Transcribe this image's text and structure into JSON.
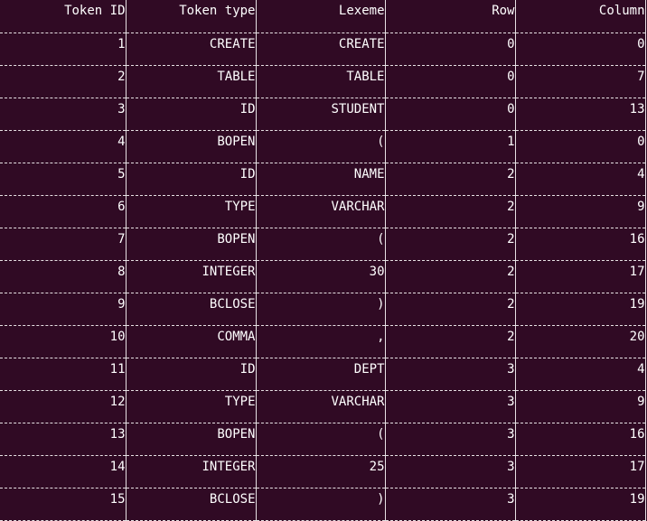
{
  "terminal": {
    "headers": [
      "Token ID",
      "Token type",
      "Lexeme",
      "Row",
      "Column"
    ],
    "rows": [
      [
        "1",
        "CREATE",
        "CREATE",
        "0",
        "0"
      ],
      [
        "2",
        "TABLE",
        "TABLE",
        "0",
        "7"
      ],
      [
        "3",
        "ID",
        "STUDENT",
        "0",
        "13"
      ],
      [
        "4",
        "BOPEN",
        "(",
        "1",
        "0"
      ],
      [
        "5",
        "ID",
        "NAME",
        "2",
        "4"
      ],
      [
        "6",
        "TYPE",
        "VARCHAR",
        "2",
        "9"
      ],
      [
        "7",
        "BOPEN",
        "(",
        "2",
        "16"
      ],
      [
        "8",
        "INTEGER",
        "30",
        "2",
        "17"
      ],
      [
        "9",
        "BCLOSE",
        ")",
        "2",
        "19"
      ],
      [
        "10",
        "COMMA",
        ",",
        "2",
        "20"
      ],
      [
        "11",
        "ID",
        "DEPT",
        "3",
        "4"
      ],
      [
        "12",
        "TYPE",
        "VARCHAR",
        "3",
        "9"
      ],
      [
        "13",
        "BOPEN",
        "(",
        "3",
        "16"
      ],
      [
        "14",
        "INTEGER",
        "25",
        "3",
        "17"
      ],
      [
        "15",
        "BCLOSE",
        ")",
        "3",
        "19"
      ]
    ]
  },
  "colors": {
    "background": "#300a24",
    "foreground": "#ffffff"
  }
}
